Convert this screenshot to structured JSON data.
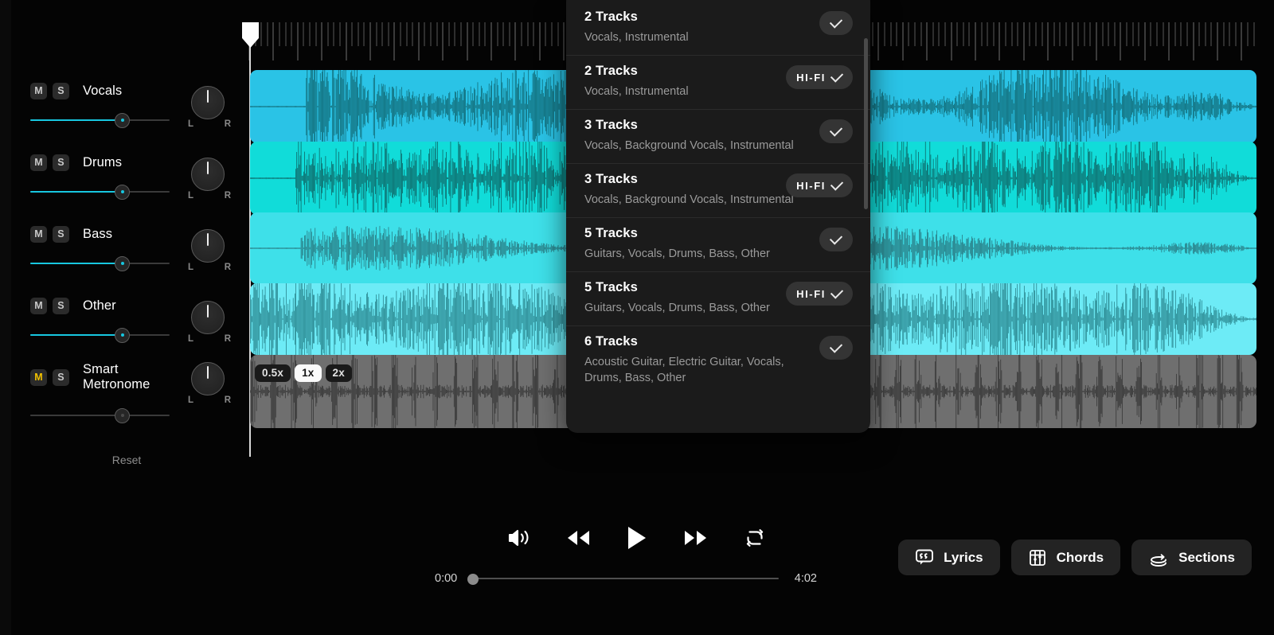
{
  "mixer": {
    "channels": [
      {
        "name": "Vocals",
        "mute_label": "M",
        "solo_label": "S",
        "muted": false,
        "volume_pct": 70,
        "pan": "center",
        "pan_left_label": "L",
        "pan_right_label": "R"
      },
      {
        "name": "Drums",
        "mute_label": "M",
        "solo_label": "S",
        "muted": false,
        "volume_pct": 70,
        "pan": "center",
        "pan_left_label": "L",
        "pan_right_label": "R"
      },
      {
        "name": "Bass",
        "mute_label": "M",
        "solo_label": "S",
        "muted": false,
        "volume_pct": 70,
        "pan": "center",
        "pan_left_label": "L",
        "pan_right_label": "R"
      },
      {
        "name": "Other",
        "mute_label": "M",
        "solo_label": "S",
        "muted": false,
        "volume_pct": 70,
        "pan": "center",
        "pan_left_label": "L",
        "pan_right_label": "R"
      },
      {
        "name": "Smart\nMetronome",
        "mute_label": "M",
        "solo_label": "S",
        "muted": true,
        "volume_pct": 70,
        "pan": "center",
        "pan_left_label": "L",
        "pan_right_label": "R"
      }
    ],
    "reset_label": "Reset"
  },
  "timeline": {
    "playhead_time": "0:00",
    "speed_options": [
      {
        "label": "0.5x",
        "active": false
      },
      {
        "label": "1x",
        "active": true
      },
      {
        "label": "2x",
        "active": false
      }
    ],
    "tracks": [
      {
        "name": "Vocals",
        "color": "#2ac3e6"
      },
      {
        "name": "Drums",
        "color": "#11dcd9"
      },
      {
        "name": "Bass",
        "color": "#3ee0e9"
      },
      {
        "name": "Other",
        "color": "#6debf6"
      },
      {
        "name": "Smart Metronome",
        "color": "#6f6f6f"
      }
    ]
  },
  "track_menu": {
    "items": [
      {
        "title": "2 Tracks",
        "subtitle": "Vocals, Instrumental",
        "hifi": false,
        "hifi_label": "",
        "selected": true
      },
      {
        "title": "2 Tracks",
        "subtitle": "Vocals, Instrumental",
        "hifi": true,
        "hifi_label": "HI-FI",
        "selected": true
      },
      {
        "title": "3 Tracks",
        "subtitle": "Vocals, Background Vocals, Instrumental",
        "hifi": false,
        "hifi_label": "",
        "selected": true
      },
      {
        "title": "3 Tracks",
        "subtitle": "Vocals, Background Vocals, Instrumental",
        "hifi": true,
        "hifi_label": "HI-FI",
        "selected": true
      },
      {
        "title": "5 Tracks",
        "subtitle": "Guitars, Vocals, Drums, Bass, Other",
        "hifi": false,
        "hifi_label": "",
        "selected": true
      },
      {
        "title": "5 Tracks",
        "subtitle": "Guitars, Vocals, Drums, Bass, Other",
        "hifi": true,
        "hifi_label": "HI-FI",
        "selected": true
      },
      {
        "title": "6 Tracks",
        "subtitle": "Acoustic Guitar, Electric Guitar, Vocals, Drums, Bass, Other",
        "hifi": false,
        "hifi_label": "",
        "selected": true
      }
    ]
  },
  "transport": {
    "controls": [
      {
        "icon": "volume-icon",
        "label": "Volume"
      },
      {
        "icon": "rewind-icon",
        "label": "Rewind"
      },
      {
        "icon": "play-icon",
        "label": "Play"
      },
      {
        "icon": "fast-forward-icon",
        "label": "Fast forward"
      },
      {
        "icon": "loop-icon",
        "label": "Loop"
      }
    ],
    "current_time": "0:00",
    "total_time": "4:02",
    "progress_pct": 0
  },
  "panel_buttons": [
    {
      "label": "Lyrics",
      "icon": "lyrics-icon"
    },
    {
      "label": "Chords",
      "icon": "chords-icon"
    },
    {
      "label": "Sections",
      "icon": "sections-icon"
    }
  ],
  "colors": {
    "accent": "#17c7e0",
    "muted_amber": "#f2c200",
    "panel_bg": "#1b1b1b",
    "app_bg": "#040404"
  }
}
